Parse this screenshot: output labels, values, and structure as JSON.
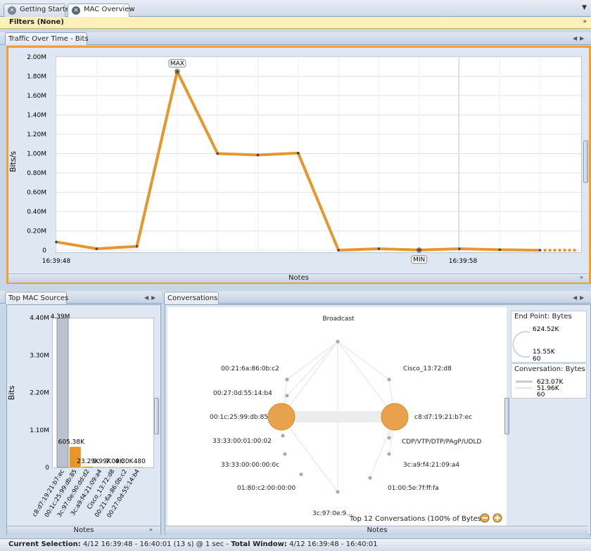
{
  "tabs": [
    {
      "label": "Getting Started",
      "active": false
    },
    {
      "label": "MAC Overview",
      "active": true
    }
  ],
  "filters": {
    "label": "Filters (None)"
  },
  "traffic_panel": {
    "title": "Traffic Over Time - Bits",
    "ylabel": "Bits/s",
    "notes_label": "Notes",
    "max_label": "MAX",
    "min_label": "MIN"
  },
  "mac_sources_panel": {
    "title": "Top MAC Sources",
    "ylabel": "Bits",
    "notes_label": "Notes"
  },
  "conversations_panel": {
    "title": "Conversations",
    "notes_label": "Notes",
    "footer_text": "Top 12 Conversations  (100% of Bytes)",
    "nodes": [
      {
        "label": "Broadcast"
      },
      {
        "label": "Cisco_13:72:d8"
      },
      {
        "label": "c8:d7:19:21:b7:ec"
      },
      {
        "label": "CDP/VTP/DTP/PAgP/UDLD"
      },
      {
        "label": "3c:a9:f4:21:09:a4"
      },
      {
        "label": "01:00:5e:7f:ff:fa"
      },
      {
        "label": "3c:97:0e:9..."
      },
      {
        "label": "01:80:c2:00:00:00"
      },
      {
        "label": "33:33:00:00:00:0c"
      },
      {
        "label": "33:33:00:01:00:02"
      },
      {
        "label": "00:1c:25:99:db:85"
      },
      {
        "label": "00:27:0d:55:14:b4"
      },
      {
        "label": "00:21:6a:86:0b:c2"
      }
    ],
    "legend_endpoint": {
      "title": "End Point: Bytes",
      "max": "624.52K",
      "mid": "15.55K",
      "min": "60"
    },
    "legend_conversation": {
      "title": "Conversation: Bytes",
      "max": "623.07K",
      "mid": "51.96K",
      "min": "60"
    }
  },
  "status": {
    "selection_label": "Current Selection:",
    "selection_value": "4/12 16:39:48 - 16:40:01 (13 s) @ 1 sec",
    "window_label": "Total Window:",
    "window_value": "4/12 16:39:48 - 16:40:01"
  },
  "colors": {
    "accent": "#f0a030",
    "line": "#e8952b",
    "bar_gray": "#b9c2cc"
  },
  "chart_data": [
    {
      "type": "line",
      "title": "Traffic Over Time - Bits",
      "xlabel": "",
      "ylabel": "Bits/s",
      "x_tick_labels": [
        "16:39:48",
        "16:39:58"
      ],
      "y_tick_labels": [
        "0",
        "0.20M",
        "0.40M",
        "0.60M",
        "0.80M",
        "1.00M",
        "1.20M",
        "1.40M",
        "1.60M",
        "1.80M",
        "2.00M"
      ],
      "ylim": [
        0,
        2000000
      ],
      "series": [
        {
          "values": [
            85000,
            15000,
            40000,
            1850000,
            1000000,
            985000,
            1005000,
            0,
            15000,
            2000,
            15000,
            5000,
            0
          ]
        }
      ],
      "max_index": 3,
      "min_index": 9,
      "grid": true
    },
    {
      "type": "bar",
      "title": "Top MAC Sources",
      "ylabel": "Bits",
      "categories": [
        "c8:d7:19:21:b7:ec",
        "00:1c:25:99:db:85",
        "3c:97:0e:90:dd:d2",
        "3c:a9:f4:21:09:a4",
        "Cisco_13:72:d8",
        "00:21:6a:86:0b:c2",
        "00:27:0d:55:14:b4"
      ],
      "values": [
        4390000,
        605380,
        23290,
        9990,
        7090,
        4300,
        480
      ],
      "value_labels": [
        "4.39M",
        "605.38K",
        "23.29K",
        "9.99K",
        "7.09K",
        "4.30K",
        "480"
      ],
      "y_tick_labels": [
        "0",
        "1.10M",
        "2.20M",
        "3.30M",
        "4.40M"
      ],
      "ylim": [
        0,
        4400000
      ]
    }
  ]
}
